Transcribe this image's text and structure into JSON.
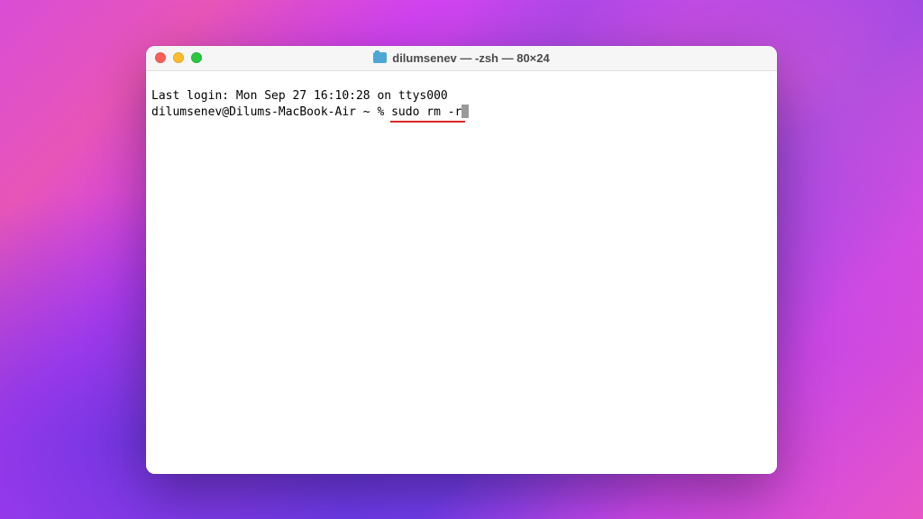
{
  "window": {
    "title": "dilumsenev — -zsh — 80×24"
  },
  "terminal": {
    "last_login_line": "Last login: Mon Sep 27 16:10:28 on ttys000",
    "prompt": "dilumsenev@Dilums-MacBook-Air ~ % ",
    "command": "sudo rm -r"
  }
}
